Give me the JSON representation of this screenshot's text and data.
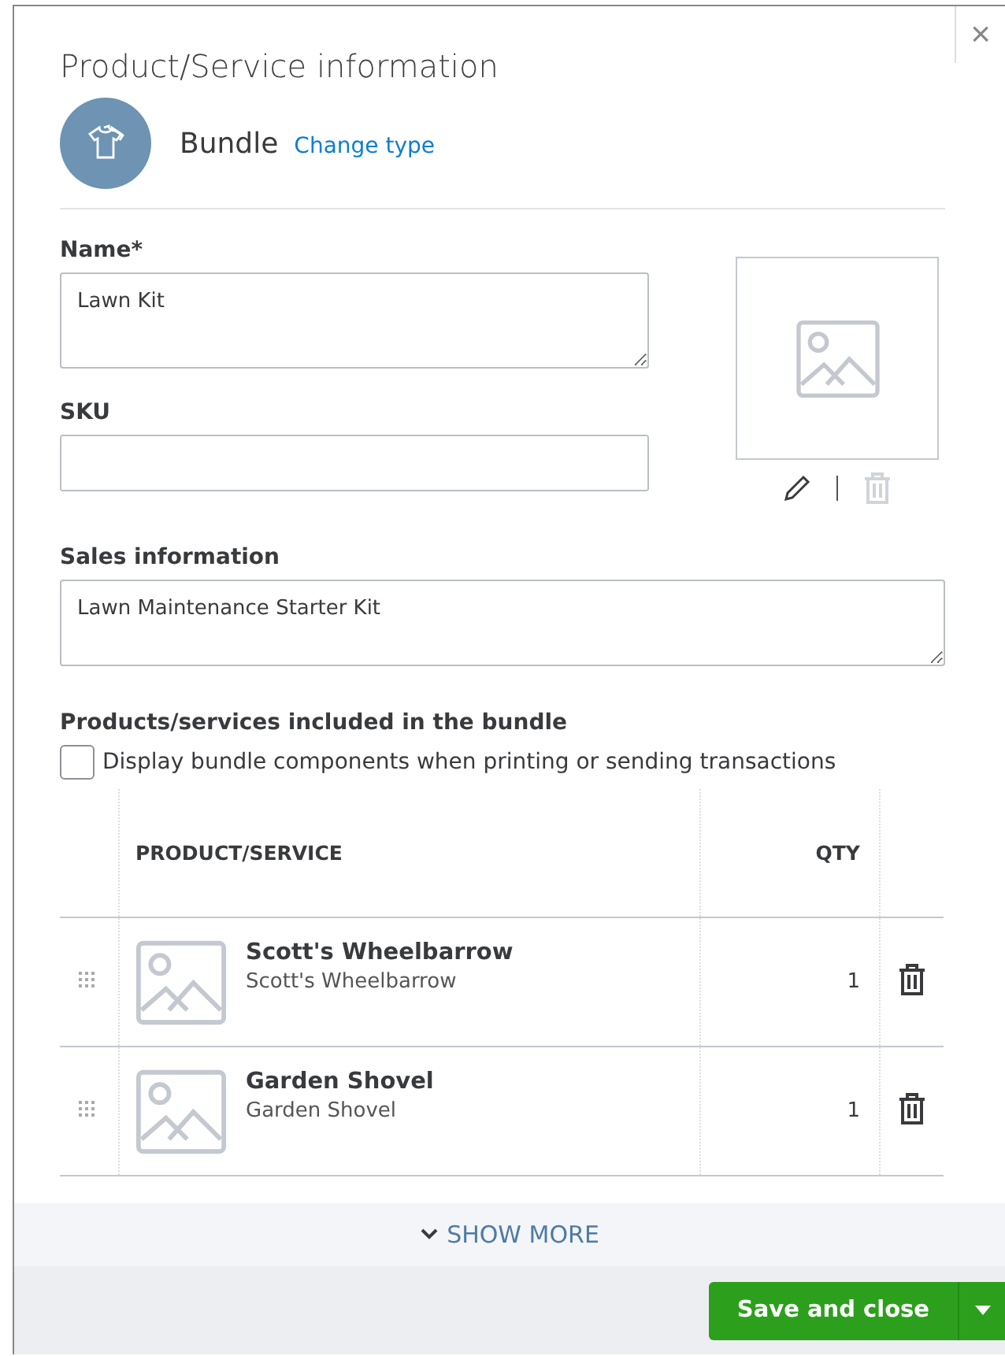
{
  "dialog": {
    "title": "Product/Service information",
    "close": "×"
  },
  "type": {
    "label": "Bundle",
    "change_link": "Change type"
  },
  "fields": [
    {
      "label": "Name*",
      "value": "Lawn Kit"
    },
    {
      "label": "SKU"
    }
  ],
  "sales": {
    "label": "Sales information",
    "value": "Lawn Maintenance Starter Kit"
  },
  "bundle": {
    "heading": "Products/services included in the bundle",
    "display_option": {
      "label": "Display bundle components when printing or sending transactions",
      "checked": false
    }
  },
  "table": {
    "columns": [
      "PRODUCT/SERVICE",
      "QTY"
    ],
    "rows": [
      {
        "name": "Scott's Wheelbarrow",
        "description": "Scott's Wheelbarrow",
        "qty": "1"
      },
      {
        "name": "Garden Shovel",
        "description": "Garden Shovel",
        "qty": "1"
      }
    ]
  },
  "show_more": "SHOW MORE",
  "footer": {
    "save": "Save and close"
  }
}
